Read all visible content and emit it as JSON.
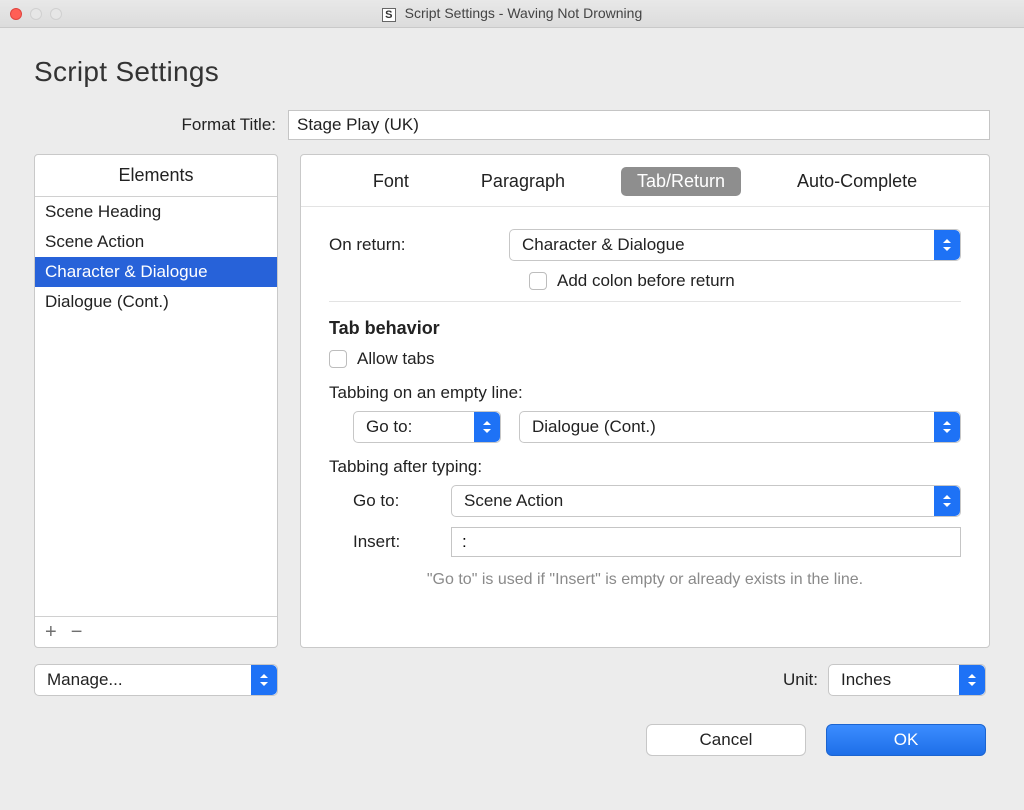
{
  "window": {
    "app_icon_glyph": "S",
    "title": "Script Settings - Waving Not Drowning"
  },
  "heading": "Script Settings",
  "format_title": {
    "label": "Format Title:",
    "value": "Stage Play (UK)"
  },
  "elements_list": {
    "header": "Elements",
    "items": [
      {
        "label": "Scene Heading",
        "selected": false
      },
      {
        "label": "Scene Action",
        "selected": false
      },
      {
        "label": "Character & Dialogue",
        "selected": true
      },
      {
        "label": "Dialogue (Cont.)",
        "selected": false
      }
    ],
    "add_glyph": "+",
    "remove_glyph": "−"
  },
  "tabs": {
    "font": "Font",
    "paragraph": "Paragraph",
    "tab_return": "Tab/Return",
    "auto_complete": "Auto-Complete"
  },
  "form": {
    "on_return_label": "On return:",
    "on_return_value": "Character & Dialogue",
    "add_colon_label": "Add colon before return",
    "tab_behavior_title": "Tab behavior",
    "allow_tabs_label": "Allow tabs",
    "tabbing_empty_label": "Tabbing on an empty line:",
    "empty_action_value": "Go to:",
    "empty_target_value": "Dialogue (Cont.)",
    "tabbing_after_label": "Tabbing after typing:",
    "after_goto_label": "Go to:",
    "after_goto_value": "Scene Action",
    "after_insert_label": "Insert:",
    "after_insert_value": ":",
    "hint": "\"Go to\" is used if \"Insert\" is empty or already exists in the line."
  },
  "footer": {
    "manage_value": "Manage...",
    "unit_label": "Unit:",
    "unit_value": "Inches",
    "cancel": "Cancel",
    "ok": "OK"
  }
}
